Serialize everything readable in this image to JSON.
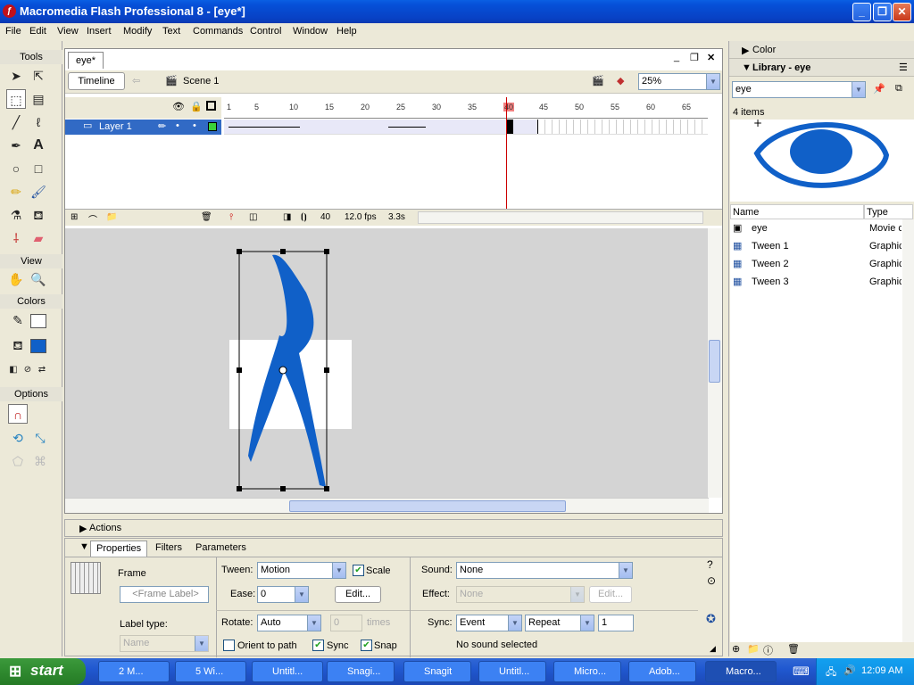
{
  "window": {
    "title": "Macromedia Flash Professional 8 - [eye*]"
  },
  "menus": [
    "File",
    "Edit",
    "View",
    "Insert",
    "Modify",
    "Text",
    "Commands",
    "Control",
    "Window",
    "Help"
  ],
  "tools": {
    "title": "Tools",
    "view_label": "View",
    "colors_label": "Colors",
    "options_label": "Options",
    "fill_color": "#1060c8",
    "stroke_color": "#ffffff"
  },
  "document": {
    "tab": "eye*",
    "timeline_button": "Timeline",
    "scene": "Scene 1",
    "zoom": "25%"
  },
  "timeline": {
    "layer": "Layer 1",
    "ruler_ticks": [
      "1",
      "5",
      "10",
      "15",
      "20",
      "25",
      "30",
      "35",
      "40",
      "45",
      "50",
      "55",
      "60",
      "65"
    ],
    "current_frame": "40",
    "fps": "12.0 fps",
    "time": "3.3s"
  },
  "actions": {
    "label": "Actions"
  },
  "properties": {
    "tabs": [
      "Properties",
      "Filters",
      "Parameters"
    ],
    "frame_label": "Frame",
    "frame_placeholder": "<Frame Label>",
    "label_type_label": "Label type:",
    "label_type_value": "Name",
    "tween_label": "Tween:",
    "tween_value": "Motion",
    "scale_label": "Scale",
    "ease_label": "Ease:",
    "ease_value": "0",
    "edit_button": "Edit...",
    "rotate_label": "Rotate:",
    "rotate_value": "Auto",
    "times_value": "0",
    "times_label": "times",
    "orient_label": "Orient to path",
    "sync_label": "Sync",
    "snap_label": "Snap",
    "sound_label": "Sound:",
    "sound_value": "None",
    "effect_label": "Effect:",
    "effect_value": "None",
    "effect_edit": "Edit...",
    "sync2_label": "Sync:",
    "sync_event": "Event",
    "sync_repeat": "Repeat",
    "repeat_count": "1",
    "no_sound": "No sound selected"
  },
  "right_panel": {
    "color_header": "Color",
    "library_header": "Library - eye",
    "library_select": "eye",
    "item_count": "4 items",
    "columns": [
      "Name",
      "Type"
    ],
    "items": [
      {
        "name": "eye",
        "type": "Movie c"
      },
      {
        "name": "Tween 1",
        "type": "Graphic"
      },
      {
        "name": "Tween 2",
        "type": "Graphic"
      },
      {
        "name": "Tween 3",
        "type": "Graphic"
      }
    ]
  },
  "taskbar": {
    "start": "start",
    "items": [
      "2 M...",
      "5 Wi...",
      "Untitl...",
      "Snagi...",
      "Snagit",
      "Untitl...",
      "Micro...",
      "Adob...",
      "Macro..."
    ],
    "clock": "12:09 AM"
  }
}
